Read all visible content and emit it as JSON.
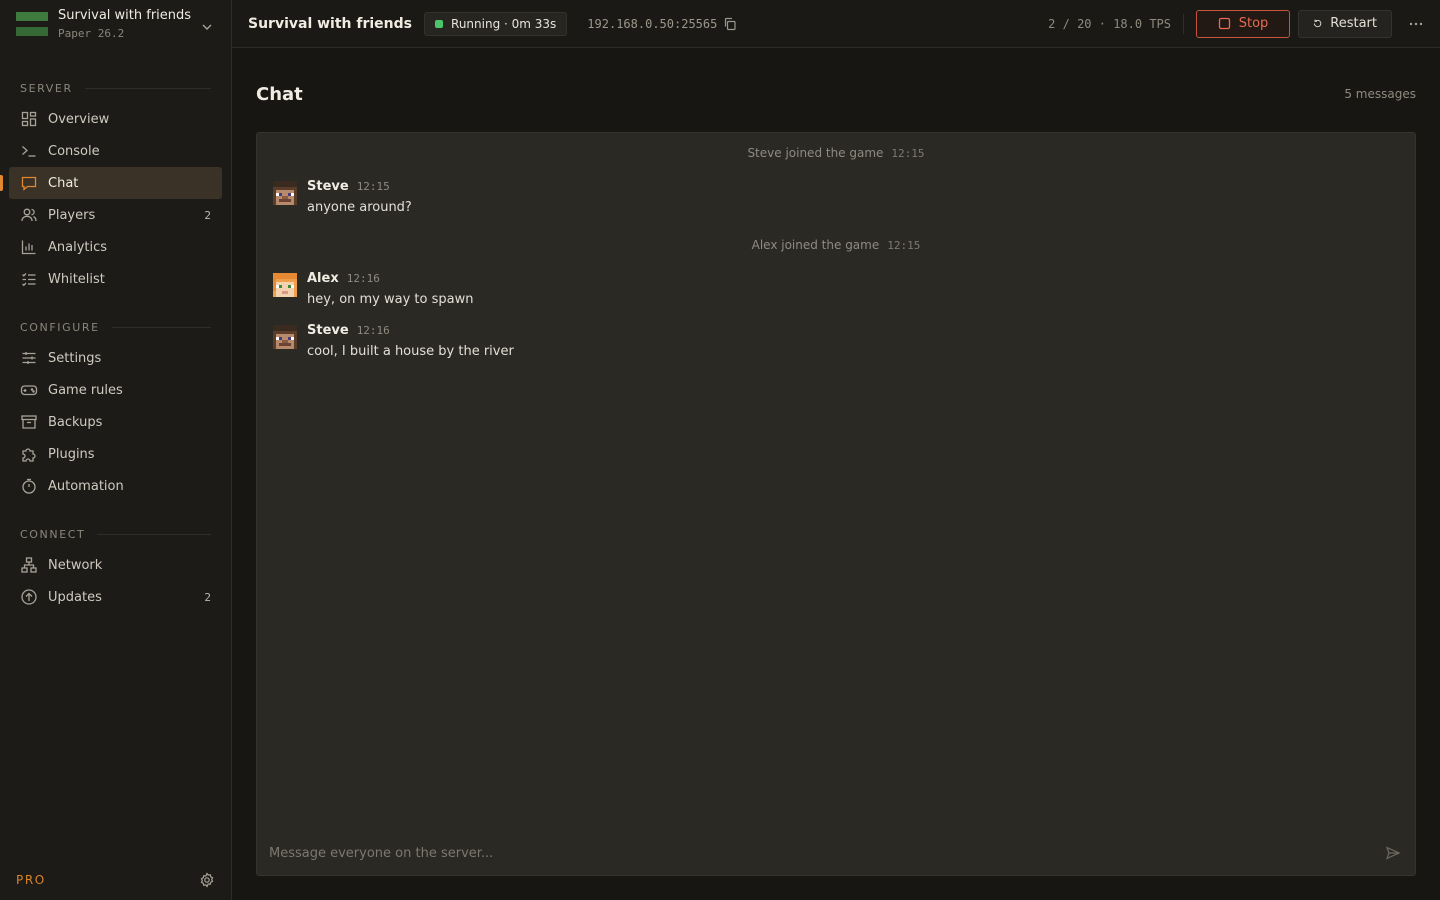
{
  "server": {
    "name": "Survival with friends",
    "version": "Paper 26.2"
  },
  "sidebar": {
    "sections": [
      {
        "title": "SERVER",
        "items": [
          {
            "label": "Overview",
            "icon": "overview-icon"
          },
          {
            "label": "Console",
            "icon": "console-icon"
          },
          {
            "label": "Chat",
            "icon": "chat-icon",
            "active": true
          },
          {
            "label": "Players",
            "icon": "players-icon",
            "count": "2"
          },
          {
            "label": "Analytics",
            "icon": "analytics-icon"
          },
          {
            "label": "Whitelist",
            "icon": "whitelist-icon"
          }
        ]
      },
      {
        "title": "CONFIGURE",
        "items": [
          {
            "label": "Settings",
            "icon": "sliders-icon"
          },
          {
            "label": "Game rules",
            "icon": "gamepad-icon"
          },
          {
            "label": "Backups",
            "icon": "archive-icon"
          },
          {
            "label": "Plugins",
            "icon": "puzzle-icon"
          },
          {
            "label": "Automation",
            "icon": "timer-icon"
          }
        ]
      },
      {
        "title": "CONNECT",
        "items": [
          {
            "label": "Network",
            "icon": "network-icon"
          },
          {
            "label": "Updates",
            "icon": "upload-circle-icon",
            "count": "2"
          }
        ]
      }
    ],
    "footer": {
      "badge": "PRO"
    }
  },
  "topbar": {
    "title": "Survival with friends",
    "status": "Running · 0m 33s",
    "address": "192.168.0.50:25565",
    "stats": "2 / 20 · 18.0 TPS",
    "stop_label": "Stop",
    "restart_label": "Restart"
  },
  "colors": {
    "accent": "#e0872f",
    "running": "#4cc46a",
    "stop": "#e66b4f"
  },
  "chat": {
    "title": "Chat",
    "count": "5 messages",
    "system1": {
      "text": "Steve joined the game",
      "time": "12:15"
    },
    "msg1": {
      "author": "Steve",
      "time": "12:15",
      "text": "anyone around?"
    },
    "system2": {
      "text": "Alex joined the game",
      "time": "12:15"
    },
    "msg2": {
      "author": "Alex",
      "time": "12:16",
      "text": "hey, on my way to spawn"
    },
    "msg3": {
      "author": "Steve",
      "time": "12:16",
      "text": "cool, I built a house by the river"
    },
    "composer_placeholder": "Message everyone on the server..."
  }
}
